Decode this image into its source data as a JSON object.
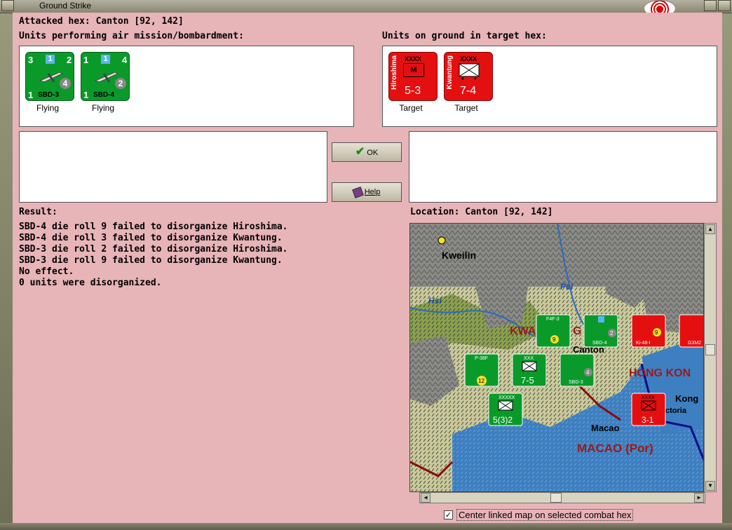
{
  "window": {
    "title": "Ground Strike"
  },
  "header": {
    "attacked_hex": "Attacked hex: Canton  [92, 142]"
  },
  "air_units": {
    "label": "Units performing air mission/bombardment:",
    "items": [
      {
        "name": "SBD-3",
        "left_top": "3",
        "right_top": "2",
        "badge": "1",
        "strength": "4",
        "bottom_left": "1",
        "status": "Flying"
      },
      {
        "name": "SBD-4",
        "left_top": "1",
        "right_top": "4",
        "badge": "1",
        "strength": "2",
        "bottom_left": "1",
        "status": "Flying"
      }
    ]
  },
  "ground_units": {
    "label": "Units on ground in target hex:",
    "items": [
      {
        "name": "Hiroshima",
        "size": "XXXX",
        "symbol": "M",
        "rating": "5-3",
        "status": "Target"
      },
      {
        "name": "Kwantung",
        "size": "XXXX",
        "symbol": "",
        "rating": "7-4",
        "status": "Target"
      }
    ]
  },
  "buttons": {
    "ok": "OK",
    "help": "Help"
  },
  "result": {
    "label": "Result:",
    "lines": [
      "SBD-4 die roll 9 failed to disorganize Hiroshima.",
      "SBD-4 die roll 3 failed to disorganize Kwantung.",
      "SBD-3 die roll 2 failed to disorganize Hiroshima.",
      "SBD-3 die roll 9 failed to disorganize Kwantung.",
      "No effect.",
      "0 units were disorganized."
    ]
  },
  "location": {
    "label": "Location:  Canton  [92, 142]",
    "map_labels": {
      "kweilin": "Kweilin",
      "pei": "Pei",
      "hsi": "Hsi",
      "kwang": "KWA",
      "kwang2": "G",
      "canton": "Canton",
      "hong_kong_region": "HONG KON",
      "hong_kong_city": "Kong",
      "victoria": "ctoria",
      "macao_city": "Macao",
      "macao_region": "MACAO (Por)"
    },
    "map_units": [
      {
        "name": "F4F-3",
        "value": "9"
      },
      {
        "name": "SBD-4",
        "value": "2"
      },
      {
        "name": "Ki-48-I",
        "value": "9"
      },
      {
        "name": "G3M2",
        "value": ""
      },
      {
        "name": "P-38F",
        "value": "12"
      },
      {
        "name": "XXX",
        "value": "7-5"
      },
      {
        "name": "SBD-3",
        "value": "4"
      },
      {
        "name": "XXXXX",
        "value": "5(3)2"
      },
      {
        "name": "XXXX",
        "value": "3-1"
      }
    ]
  },
  "options": {
    "center_map": "Center linked map on selected combat hex",
    "center_map_checked": true
  }
}
